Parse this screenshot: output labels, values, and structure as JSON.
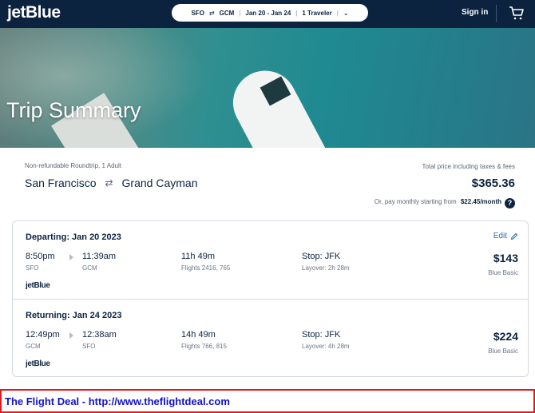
{
  "nav": {
    "logo": "jetBlue",
    "search": {
      "origin": "SFO",
      "swap_icon": "⇄",
      "destination": "GCM",
      "dates": "Jan 20 - Jan 24",
      "travelers": "1 Traveler",
      "chevron": "⌄"
    },
    "signin_label": "Sign in",
    "cart_icon": "cart-icon"
  },
  "hero": {
    "title": "Trip Summary"
  },
  "summary": {
    "fare_type": "Non-refundable Roundtrip, 1 Adult",
    "origin_city": "San Francisco",
    "swap_icon": "⇄",
    "destination_city": "Grand Cayman",
    "price_label": "Total price including taxes & fees",
    "total_price": "$365.36",
    "monthly_text": "Or, pay monthly starting from",
    "monthly_amount": "$22.45/month",
    "help_icon": "?"
  },
  "flights": [
    {
      "title": "Departing: Jan 20 2023",
      "edit_label": "Edit",
      "depart_time": "8:50pm",
      "depart_airport": "SFO",
      "arrive_time": "11:39am",
      "arrive_airport": "GCM",
      "duration": "11h 49m",
      "flight_numbers": "Flights 2416, 765",
      "stop": "Stop: JFK",
      "layover": "Layover: 2h 28m",
      "price": "$143",
      "fare_class": "Blue Basic",
      "carrier": "jetBlue"
    },
    {
      "title": "Returning: Jan 24 2023",
      "depart_time": "12:49pm",
      "depart_airport": "GCM",
      "arrive_time": "12:38am",
      "arrive_airport": "SFO",
      "duration": "14h 49m",
      "flight_numbers": "Flights 766, 815",
      "stop": "Stop: JFK",
      "layover": "Layover: 4h 28m",
      "price": "$224",
      "fare_class": "Blue Basic",
      "carrier": "jetBlue"
    }
  ],
  "banner": {
    "text": "The Flight Deal - http://www.theflightdeal.com"
  },
  "colors": {
    "navy": "#0c2340",
    "link": "#2a6fb4",
    "banner_border": "#e01b1b",
    "banner_text": "#1212c8"
  }
}
